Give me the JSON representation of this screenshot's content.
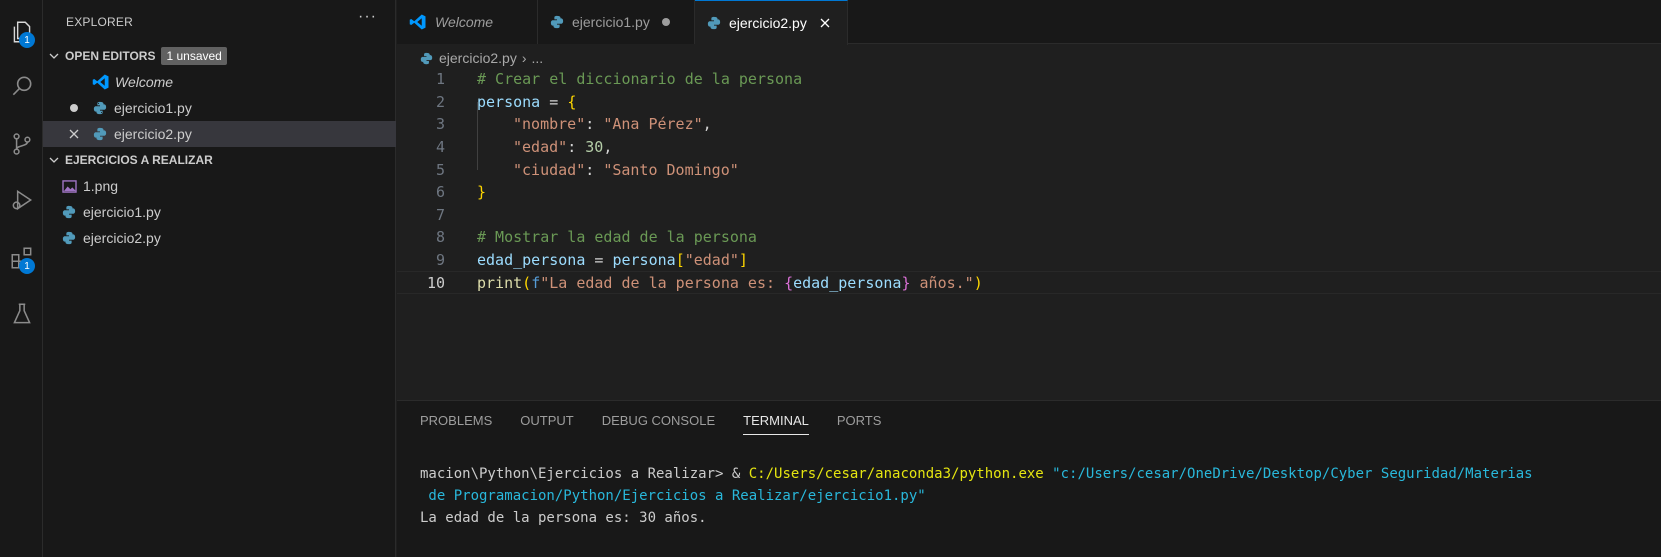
{
  "activity_bar": {
    "explorer_badge": "1",
    "extensions_badge": "1"
  },
  "sidebar": {
    "title": "EXPLORER",
    "more": "···",
    "open_editors": {
      "label": "OPEN EDITORS",
      "badge": "1 unsaved",
      "items": [
        {
          "label": "Welcome"
        },
        {
          "label": "ejercicio1.py"
        },
        {
          "label": "ejercicio2.py"
        }
      ]
    },
    "folder": {
      "label": "EJERCICIOS A REALIZAR",
      "items": [
        {
          "label": "1.png"
        },
        {
          "label": "ejercicio1.py"
        },
        {
          "label": "ejercicio2.py"
        }
      ]
    }
  },
  "tabs": [
    {
      "label": "Welcome"
    },
    {
      "label": "ejercicio1.py"
    },
    {
      "label": "ejercicio2.py"
    }
  ],
  "breadcrumb": {
    "file": "ejercicio2.py",
    "sep": "›",
    "rest": "..."
  },
  "editor": {
    "line_numbers": [
      "1",
      "2",
      "3",
      "4",
      "5",
      "6",
      "7",
      "8",
      "9",
      "10"
    ],
    "code": {
      "l1": "# Crear el diccionario de la persona",
      "l2_var": "persona",
      "l2_op": " = ",
      "l2_br": "{",
      "l3_key": "\"nombre\"",
      "l3_colon": ": ",
      "l3_val": "\"Ana Pérez\"",
      "l3_comma": ",",
      "l4_key": "\"edad\"",
      "l4_colon": ": ",
      "l4_val": "30",
      "l4_comma": ",",
      "l5_key": "\"ciudad\"",
      "l5_colon": ": ",
      "l5_val": "\"Santo Domingo\"",
      "l6_br": "}",
      "l8": "# Mostrar la edad de la persona",
      "l9_var": "edad_persona",
      "l9_op": " = ",
      "l9_var2": "persona",
      "l9_br1": "[",
      "l9_key": "\"edad\"",
      "l9_br2": "]",
      "l10_fn": "print",
      "l10_br1": "(",
      "l10_f": "f",
      "l10_s1": "\"La edad de la persona es: ",
      "l10_cb1": "{",
      "l10_var": "edad_persona",
      "l10_cb2": "}",
      "l10_s2": " años.\"",
      "l10_br2": ")"
    }
  },
  "panel": {
    "tabs": [
      "PROBLEMS",
      "OUTPUT",
      "DEBUG CONSOLE",
      "TERMINAL",
      "PORTS"
    ],
    "terminal": {
      "prompt": "macion\\Python\\Ejercicios a Realizar> & ",
      "exe": "C:/Users/cesar/anaconda3/python.exe",
      "arg1": " \"c:/Users/cesar/OneDrive/Desktop/Cyber Seguridad/Materias",
      "arg2": " de Programacion/Python/Ejercicios a Realizar/ejercicio1.py\"",
      "output": "La edad de la persona es: 30 años."
    }
  },
  "colors": {
    "accent": "#0078d4",
    "python_icon": "#519aba",
    "vscode_icon": "#0098ff"
  }
}
